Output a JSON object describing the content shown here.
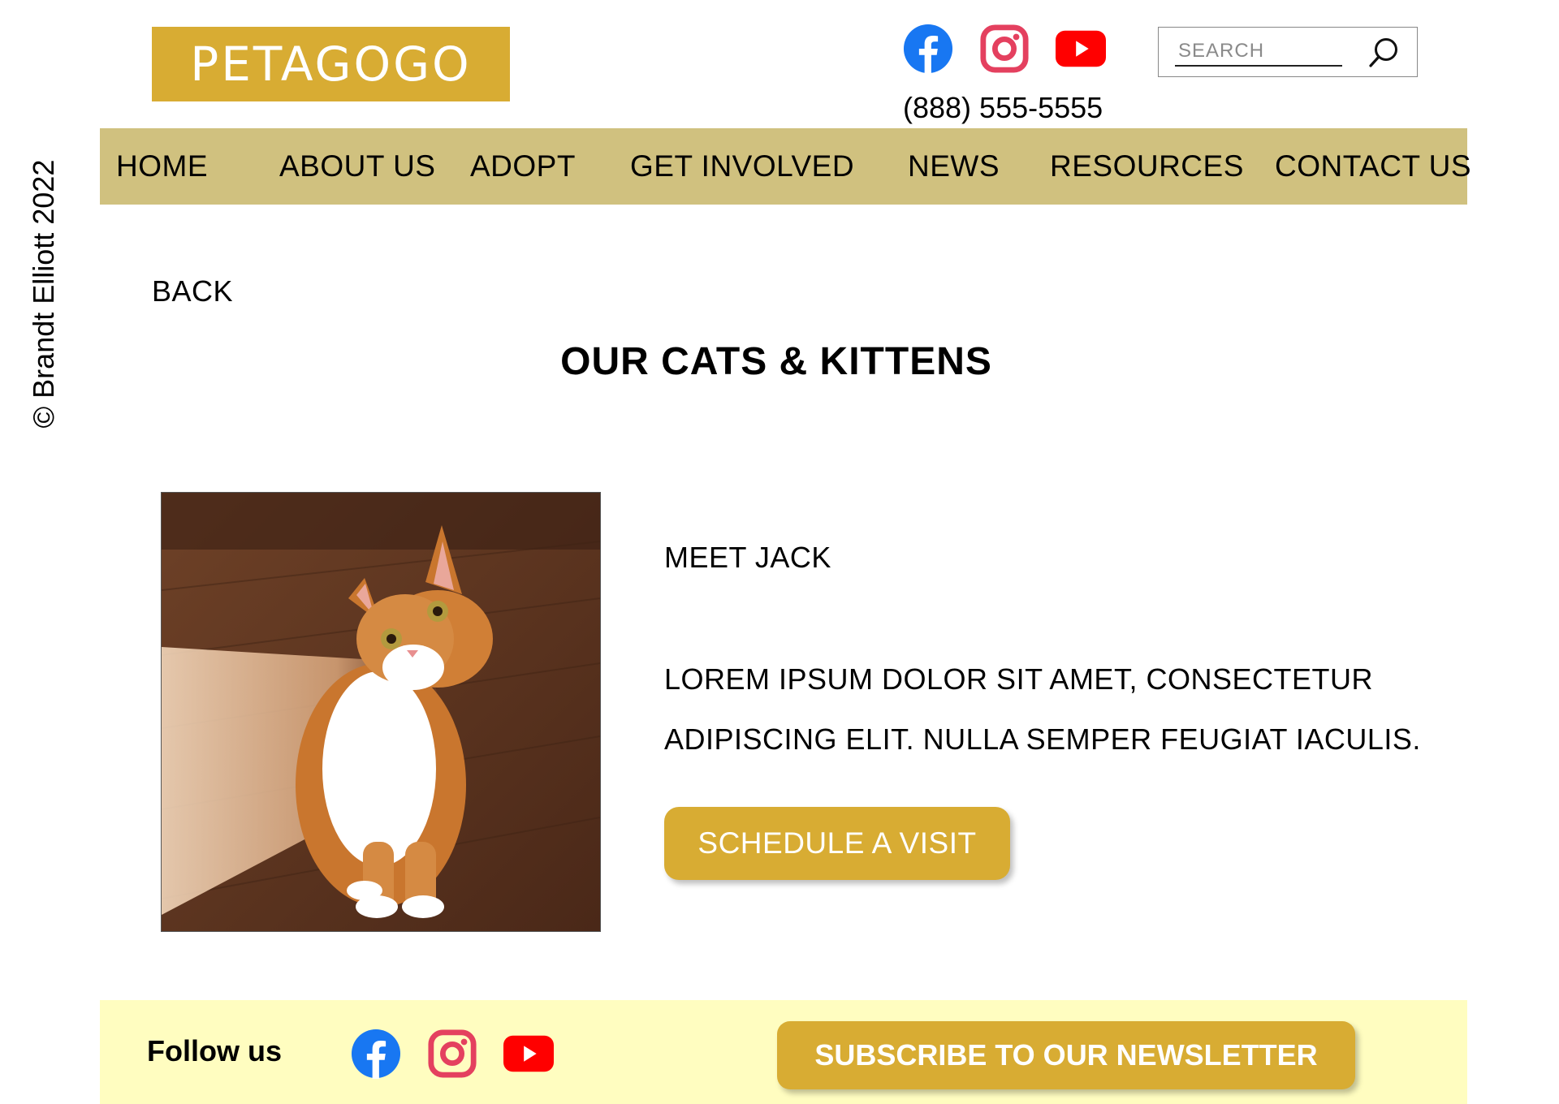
{
  "copyright": "© Brandt Elliott 2022",
  "header": {
    "logo_text": "PETAGOGO",
    "phone": "(888) 555-5555",
    "search_placeholder": "SEARCH",
    "social_icons": [
      "facebook-icon",
      "instagram-icon",
      "youtube-icon"
    ]
  },
  "nav": {
    "items": [
      "HOME",
      "ABOUT US",
      "ADOPT",
      "GET INVOLVED",
      "NEWS",
      "RESOURCES",
      "CONTACT US"
    ]
  },
  "main": {
    "back_label": "BACK",
    "title": "OUR CATS & KITTENS",
    "pet_name": "MEET JACK",
    "description": "LOREM IPSUM DOLOR SIT AMET, CONSECTETUR ADIPISCING ELIT. NULLA SEMPER FEUGIAT IACULIS.",
    "schedule_button": "SCHEDULE A VISIT",
    "photo_icon": "cat-photo"
  },
  "footer": {
    "follow_label": "Follow us",
    "social_icons": [
      "facebook-icon",
      "instagram-icon",
      "youtube-icon"
    ],
    "newsletter_button": "SUBSCRIBE TO OUR NEWSLETTER"
  },
  "colors": {
    "brand_gold": "#d8ac33",
    "nav_background": "#d0c17f",
    "footer_background": "#fffdc0",
    "facebook_blue": "#1877f2",
    "instagram_pink": "#e4405f",
    "youtube_red": "#ff0000"
  }
}
